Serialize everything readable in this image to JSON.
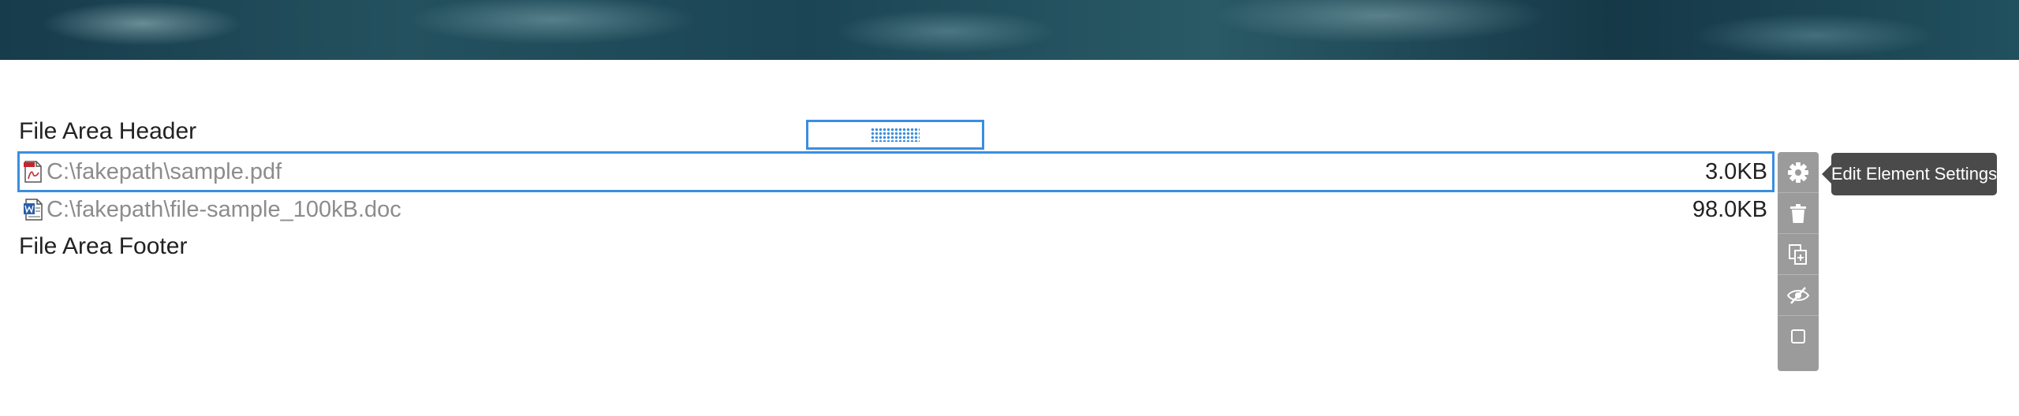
{
  "file_area": {
    "header": "File Area Header",
    "footer": "File Area Footer",
    "files": [
      {
        "name": "C:\\fakepath\\sample.pdf",
        "size": "3.0KB",
        "icon": "pdf-file-icon",
        "selected": true
      },
      {
        "name": "C:\\fakepath\\file-sample_100kB.doc",
        "size": "98.0KB",
        "icon": "word-doc-icon",
        "selected": false
      }
    ]
  },
  "toolbar": {
    "buttons": [
      {
        "icon": "gear-icon",
        "label": "Edit Element Settings"
      },
      {
        "icon": "trash-icon"
      },
      {
        "icon": "duplicate-icon"
      },
      {
        "icon": "eye-slash-icon"
      },
      {
        "icon": "square-icon"
      }
    ],
    "tooltip": "Edit Element Settings"
  },
  "colors": {
    "selection_blue": "#3a8ee0",
    "toolbar_gray": "#9b9b9b",
    "tooltip_bg": "#4a4a4a",
    "file_name_gray": "#8c8c8c"
  }
}
